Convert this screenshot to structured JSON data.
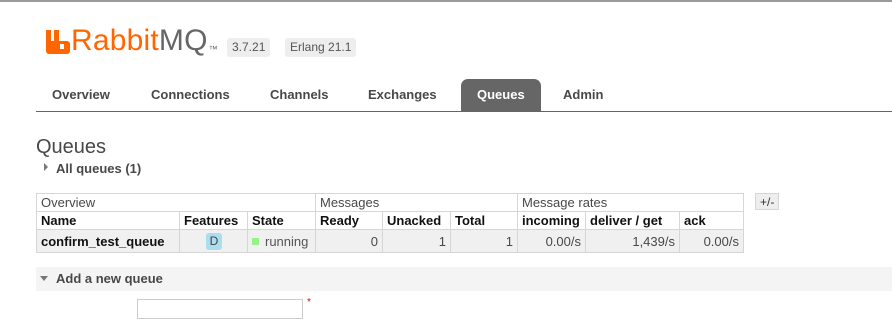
{
  "header": {
    "logo_primary": "Rabbit",
    "logo_secondary": "MQ",
    "logo_tm": "™",
    "version": "3.7.21",
    "erlang": "Erlang 21.1",
    "brand_color": "#ff6600"
  },
  "nav": {
    "tabs": [
      {
        "label": "Overview",
        "active": false
      },
      {
        "label": "Connections",
        "active": false
      },
      {
        "label": "Channels",
        "active": false
      },
      {
        "label": "Exchanges",
        "active": false
      },
      {
        "label": "Queues",
        "active": true
      },
      {
        "label": "Admin",
        "active": false
      }
    ]
  },
  "page": {
    "title": "Queues",
    "all_queues_label": "All queues (1)"
  },
  "table": {
    "groups": [
      "Overview",
      "Messages",
      "Message rates"
    ],
    "columns": [
      "Name",
      "Features",
      "State",
      "Ready",
      "Unacked",
      "Total",
      "incoming",
      "deliver / get",
      "ack"
    ],
    "rows": [
      {
        "name": "confirm_test_queue",
        "feature": "D",
        "state": "running",
        "ready": "0",
        "unacked": "1",
        "total": "1",
        "incoming": "0.00/s",
        "deliver_get": "1,439/s",
        "ack": "0.00/s"
      }
    ],
    "toggle_columns_label": "+/-",
    "state_color": "#98f28a",
    "feature_badge_color": "#aaddee"
  },
  "add_queue": {
    "label": "Add a new queue",
    "required_mark": "*"
  }
}
